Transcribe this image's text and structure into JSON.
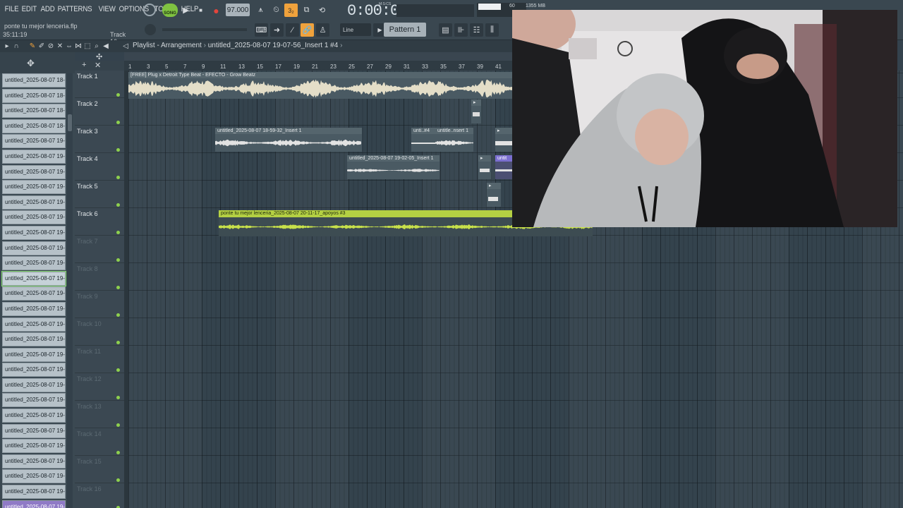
{
  "menu": [
    "FILE",
    "EDIT",
    "ADD",
    "PATTERNS",
    "VIEW",
    "OPTIONS",
    "TOOLS",
    "HELP"
  ],
  "song_info": {
    "project_name": "ponte tu mejor lenceria.flp",
    "time": "35:11:19",
    "hint_track": "Track 16"
  },
  "transport": {
    "song_mode": "SONG",
    "tempo": "97.000",
    "time": "0:00:00",
    "time_unit": "M:S:CS",
    "cpu": "60",
    "memory": "1355 MB",
    "snap": "Line",
    "pattern": "Pattern 1"
  },
  "playlist": {
    "title": "Playlist - Arrangement",
    "breadcrumb": "untitled_2025-08-07 19-07-56_Insert 1 #4",
    "ruler": [
      "1",
      "3",
      "5",
      "7",
      "9",
      "11",
      "13",
      "15",
      "17",
      "19",
      "21",
      "23",
      "25",
      "27",
      "29",
      "31",
      "33",
      "35",
      "37",
      "39",
      "41"
    ]
  },
  "browser": {
    "items": [
      "untitled_2025-08-07 18-…",
      "untitled_2025-08-07 18-…",
      "untitled_2025-08-07 18-…",
      "untitled_2025-08-07 18-…",
      "untitled_2025-08-07 19-…",
      "untitled_2025-08-07 19-…",
      "untitled_2025-08-07 19-…",
      "untitled_2025-08-07 19-…",
      "untitled_2025-08-07 19-…",
      "untitled_2025-08-07 19-…",
      "untitled_2025-08-07 19-…",
      "untitled_2025-08-07 19-…",
      "untitled_2025-08-07 19-…",
      "untitled_2025-08-07 19-…",
      "untitled_2025-08-07 19-…",
      "untitled_2025-08-07 19-…",
      "untitled_2025-08-07 19-…",
      "untitled_2025-08-07 19-…",
      "untitled_2025-08-07 19-…",
      "untitled_2025-08-07 19-…",
      "untitled_2025-08-07 19-…",
      "untitled_2025-08-07 19-…",
      "untitled_2025-08-07 19-…",
      "untitled_2025-08-07 19-…",
      "untitled_2025-08-07 19-…",
      "untitled_2025-08-07 19-…",
      "untitled_2025-08-07 19-…",
      "untitled_2025-08-07 19-…",
      "untitled_2025-08-07 19-…",
      "untitled_2025-08-07 19-…"
    ],
    "selected_index": 13,
    "highlighted_index": 28
  },
  "tracks": [
    {
      "name": "Track 1",
      "active": true
    },
    {
      "name": "Track 2",
      "active": true
    },
    {
      "name": "Track 3",
      "active": true
    },
    {
      "name": "Track 4",
      "active": true
    },
    {
      "name": "Track 5",
      "active": true
    },
    {
      "name": "Track 6",
      "active": true
    },
    {
      "name": "Track 7",
      "active": false
    },
    {
      "name": "Track 8",
      "active": false
    },
    {
      "name": "Track 9",
      "active": false
    },
    {
      "name": "Track 10",
      "active": false
    },
    {
      "name": "Track 11",
      "active": false
    },
    {
      "name": "Track 12",
      "active": false
    },
    {
      "name": "Track 13",
      "active": false
    },
    {
      "name": "Track 14",
      "active": false
    },
    {
      "name": "Track 15",
      "active": false
    },
    {
      "name": "Track 16",
      "active": false
    }
  ],
  "clips": {
    "beat": "[FREE] Plug x Detroit Type Beat - EFECTO - Grow Beatz",
    "t3a": "untitled_2025-08-07 18-59-32_Insert 1",
    "t3b": "unti..#4",
    "t3c": "untitle..nsert 1",
    "t4a": "untitled_2025-08-07 19-02-05_Insert 1",
    "t4b": "untit",
    "t6": "ponte tu mejor lenceria_2025-08-07 20-11-17_apoyos #3"
  },
  "colors": {
    "accent_orange": "#f0a23c",
    "song_green": "#7fc241",
    "clip_lime": "#b4d043",
    "clip_purple": "#7b6fd0"
  }
}
